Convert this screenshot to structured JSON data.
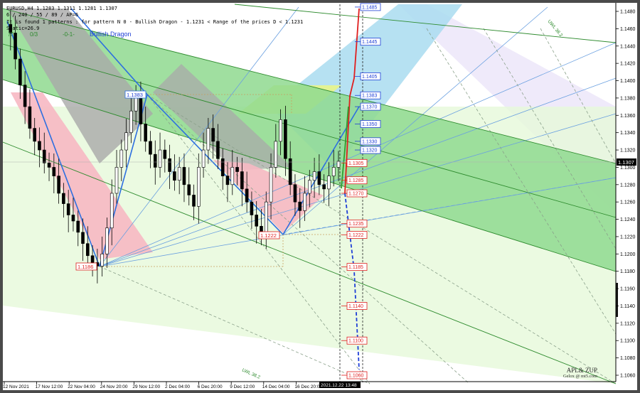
{
  "header": {
    "symbol_line": "EURUSD,H4  1.1283 1.1311 1.1281 1.1307",
    "params_line": "6 / 240 / 55 / 89 / AP=6",
    "pattern_line": "It is found 1 patterns  :   for pattern N 0 - Bullish Dragon - 1.1231 < Range of the prices D < 1.1231",
    "static_line": "Static=26.9"
  },
  "fan_labels": {
    "left_a": "/7",
    "left_b": "0/3",
    "center": "-0-1-",
    "pattern_name": "Bullish Dragon"
  },
  "line_labels": [
    "LWL 38.2",
    "UWL 38.2"
  ],
  "watermark": {
    "title": "APL& ZUP",
    "subtitle": "Gelox @ mt5.com"
  },
  "colors": {
    "background": "#ffffff",
    "green_channel": "#8fd98f",
    "pink_zone": "#f7b8c3",
    "grey_zone": "#a9a9a9",
    "light_green_zone": "#dcf7c8",
    "blue_channel": "#9fd8ee",
    "lavender_zone": "#e6e0f7",
    "yellow_zone": "#e8f58a",
    "pattern_line": "#2d6fe0",
    "red_projection": "#e01f1f",
    "green_projection": "#2e9e2e",
    "blue_projection": "#1f3fd6",
    "candle": "#000000"
  },
  "chart_data": {
    "type": "candlestick",
    "symbol": "EURUSD",
    "timeframe": "H4",
    "ohlc_last": {
      "open": 1.1283,
      "high": 1.1311,
      "low": 1.1281,
      "close": 1.1307
    },
    "current_price": "1.1307",
    "ylim": [
      1.1052,
      1.1488
    ],
    "price_ticks": [
      "1.1480",
      "1.1460",
      "1.1440",
      "1.1420",
      "1.1400",
      "1.1380",
      "1.1360",
      "1.1340",
      "1.1320",
      "1.1300",
      "1.1280",
      "1.1260",
      "1.1240",
      "1.1220",
      "1.1200",
      "1.1180",
      "1.1160",
      "1.1140",
      "1.1120",
      "1.1100",
      "1.1080",
      "1.1060"
    ],
    "time_ticks": [
      "12 Nov 2021",
      "17 Nov 12:00",
      "22 Nov 04:00",
      "24 Nov 20:00",
      "29 Nov 12:00",
      "2 Dec 04:00",
      "6 Dec 20:00",
      "9 Dec 12:00",
      "14 Dec 04:00",
      "16 Dec 20:00"
    ],
    "cursor_time": "2021.12.22 13:48",
    "pattern": {
      "name": "Bullish Dragon",
      "points": [
        "1.1186",
        "1.1383",
        "1.1222"
      ]
    },
    "projection_levels_upper": [
      "1.1485",
      "1.1445",
      "1.1405",
      "1.1383",
      "1.1370",
      "1.1350",
      "1.1330",
      "1.1320"
    ],
    "projection_levels_lower": [
      "1.1305",
      "1.1285",
      "1.1270",
      "1.1235",
      "1.1222",
      "1.1185",
      "1.1140",
      "1.1100",
      "1.1060"
    ],
    "close_path": [
      1.1465,
      1.1455,
      1.1425,
      1.1395,
      1.137,
      1.1345,
      1.133,
      1.132,
      1.1305,
      1.13,
      1.129,
      1.127,
      1.1258,
      1.1245,
      1.1238,
      1.1225,
      1.1212,
      1.1198,
      1.119,
      1.1186,
      1.12,
      1.123,
      1.127,
      1.13,
      1.132,
      1.134,
      1.1365,
      1.1383,
      1.135,
      1.133,
      1.1315,
      1.13,
      1.132,
      1.131,
      1.1295,
      1.1285,
      1.13,
      1.128,
      1.1268,
      1.1255,
      1.13,
      1.132,
      1.1345,
      1.133,
      1.131,
      1.129,
      1.128,
      1.13,
      1.1295,
      1.1275,
      1.126,
      1.1245,
      1.1232,
      1.1222,
      1.126,
      1.13,
      1.133,
      1.1355,
      1.131,
      1.128,
      1.126,
      1.125,
      1.127,
      1.1285,
      1.1295,
      1.128,
      1.1275,
      1.129,
      1.13,
      1.1307
    ]
  }
}
